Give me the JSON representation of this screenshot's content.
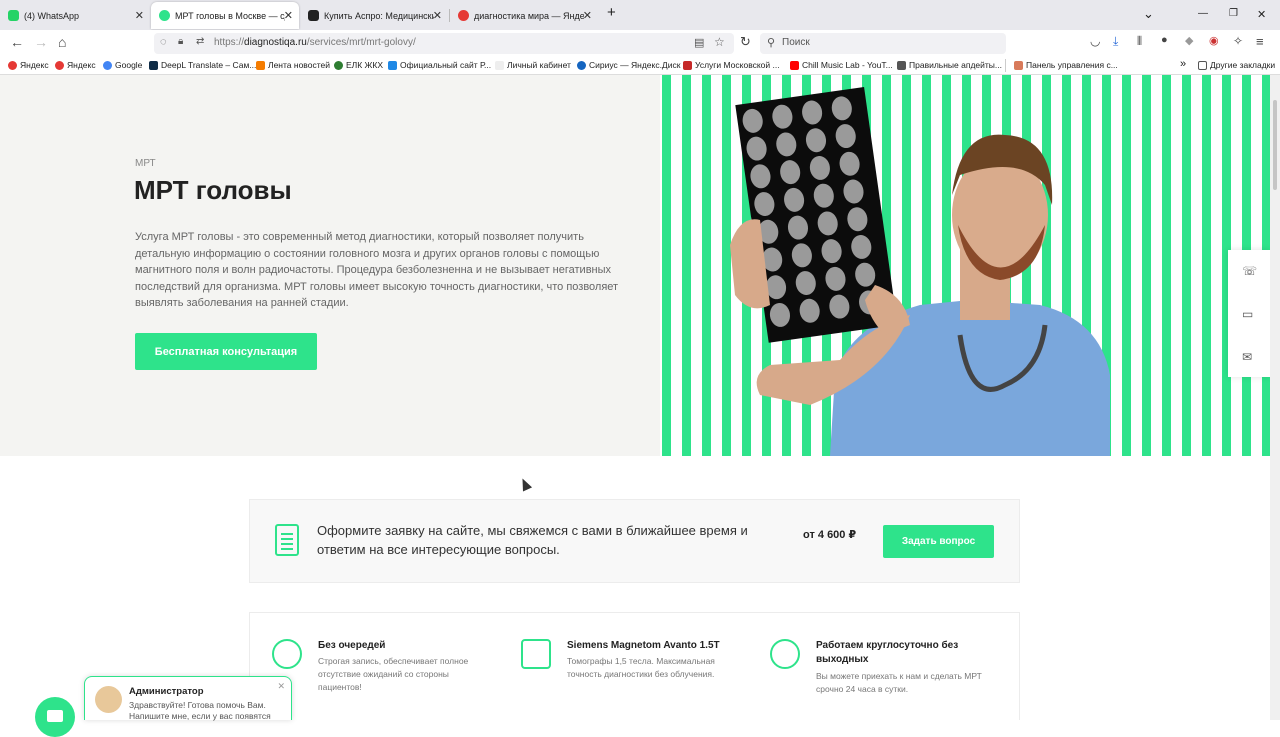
{
  "tabs": [
    {
      "label": "(4) WhatsApp",
      "color": "#25d366"
    },
    {
      "label": "МРТ головы в Москве — сделать",
      "color": "#2ee38b"
    },
    {
      "label": "Купить Аспро: Медицинский це...",
      "color": "#222222"
    },
    {
      "label": "диагностика мира — Яндекс: на...",
      "color": "#e53935"
    }
  ],
  "window": {
    "new_tab": "+",
    "dropdown": "⌄",
    "minimize": "—",
    "restore": "❐",
    "close": "✕"
  },
  "url": {
    "prefix": "https://",
    "host": "diagnostiqa.ru",
    "path": "/services/mrt/mrt-golovy/"
  },
  "search_placeholder": "Поиск",
  "bookmarks": [
    "Яндекс",
    "Яндекс",
    "Google",
    "DeepL Translate – Сам...",
    "Лента новостей",
    "ЕЛК ЖКХ",
    "Официальный сайт Р...",
    "Личный кабинет",
    "Сириус — Яндекс.Диск",
    "Услуги Московской ...",
    "Chill Music Lab - YouT...",
    "Правильные апдейты...",
    "Панель управления с...",
    "Другие закладки"
  ],
  "hero": {
    "crumb": "МРТ",
    "title": "МРТ головы",
    "description": "Услуга МРТ головы - это современный метод диагностики, который позволяет получить детальную информацию о состоянии головного мозга и других органов головы с помощью магнитного поля и волн радиочастоты. Процедура безболезненна и не вызывает негативных последствий для организма. МРТ головы имеет высокую точность диагностики, что позволяет выявлять заболевания на ранней стадии.",
    "cta": "Бесплатная консультация",
    "accent": "#2ee38b"
  },
  "request": {
    "text": "Оформите заявку на сайте, мы свяжемся с вами в ближайшее время и ответим на все интересующие вопросы.",
    "price": "от 4 600 ₽",
    "button": "Задать вопрос"
  },
  "features": [
    {
      "title": "Без очередей",
      "desc": "Строгая запись, обеспечивает полное отсутствие ожиданий со стороны пациентов!"
    },
    {
      "title": "Siemens Magnetom Avanto 1.5T",
      "desc": "Томографы 1,5 тесла. Максимальная точность диагностики без облучения."
    },
    {
      "title": "Работаем круглосуточно без выходных",
      "desc": "Вы можете приехать к нам и сделать МРТ срочно 24 часа в сутки."
    }
  ],
  "chat": {
    "name": "Администратор",
    "message": "Здравствуйте! Готова помочь Вам. Напишите мне, если у вас появятся",
    "close": "✕"
  }
}
